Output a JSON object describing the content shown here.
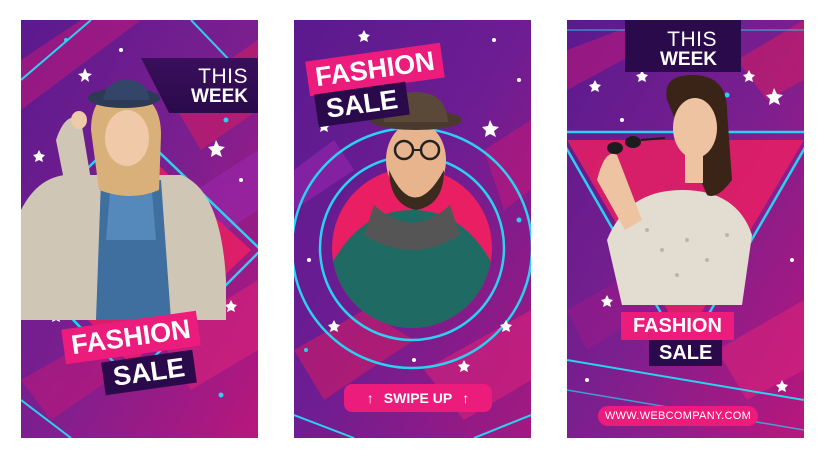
{
  "colors": {
    "purple": "#6a1b9a",
    "magenta": "#d81b60",
    "pink": "#ec1c7c",
    "cyan": "#2ad1f0",
    "dark": "#2a0a4a"
  },
  "cards": [
    {
      "this_label": "THIS",
      "week_label": "WEEK",
      "fashion_label": "FASHION",
      "sale_label": "SALE",
      "photo": "woman-with-hat-photo"
    },
    {
      "fashion_label": "FASHION",
      "sale_label": "SALE",
      "swipe_label": "SWIPE UP",
      "arrow_glyph": "↑",
      "photo": "man-with-hat-photo"
    },
    {
      "this_label": "THIS",
      "week_label": "WEEK",
      "fashion_label": "FASHION",
      "sale_label": "SALE",
      "url_label": "WWW.WEBCOMPANY.COM",
      "photo": "woman-with-sunglasses-photo"
    }
  ]
}
